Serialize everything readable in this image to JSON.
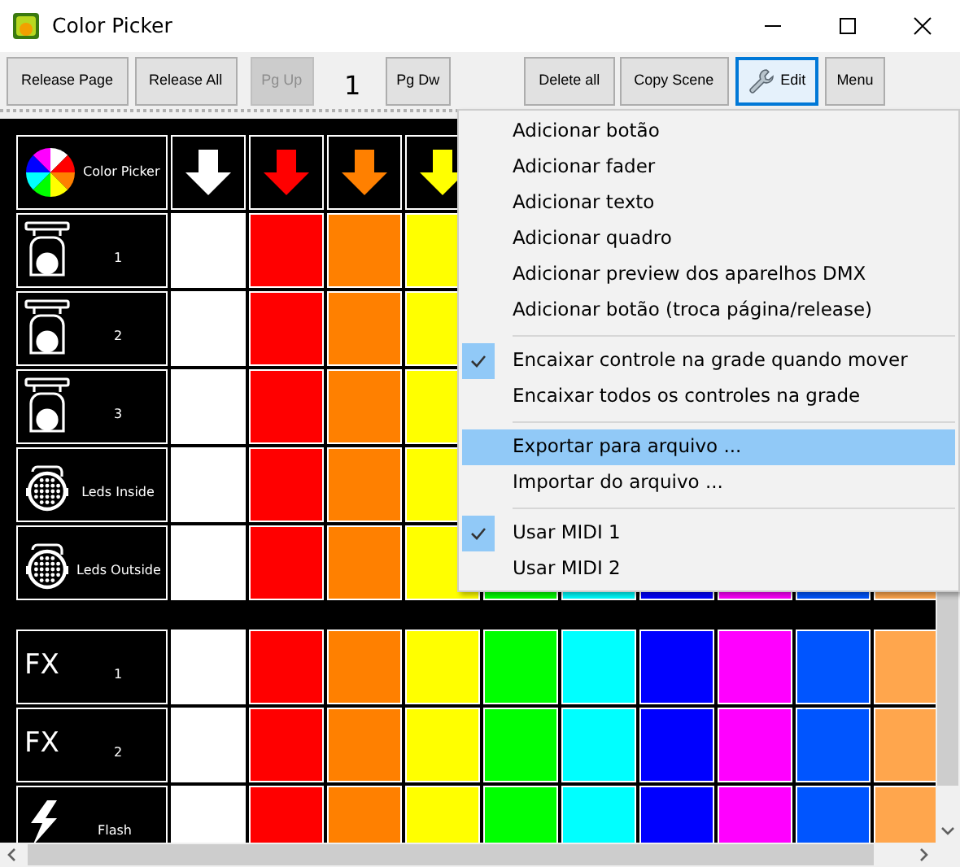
{
  "window": {
    "title": "Color Picker"
  },
  "toolbar": [
    {
      "kind": "button",
      "label": "Release Page",
      "disabled": false,
      "selected": false
    },
    {
      "kind": "button",
      "label": "Release All",
      "disabled": false,
      "selected": false
    },
    {
      "kind": "button",
      "label": "Pg Up",
      "disabled": true,
      "selected": false
    },
    {
      "kind": "page",
      "label": "1"
    },
    {
      "kind": "button",
      "label": "Pg Dw",
      "disabled": false,
      "selected": false
    },
    {
      "kind": "button",
      "label": "Delete all",
      "disabled": false,
      "selected": false
    },
    {
      "kind": "button",
      "label": "Copy Scene",
      "disabled": false,
      "selected": false
    },
    {
      "kind": "icon-button",
      "label": "Edit",
      "disabled": false,
      "selected": true
    },
    {
      "kind": "button",
      "label": "Menu",
      "disabled": false,
      "selected": false
    }
  ],
  "palette": [
    {
      "color": "#ffffff"
    },
    {
      "color": "#ff0000"
    },
    {
      "color": "#ff8000"
    },
    {
      "color": "#ffff00"
    },
    {
      "color": "#00ff00"
    },
    {
      "color": "#00ffff"
    },
    {
      "color": "#0000ff"
    },
    {
      "color": "#ff00ff"
    },
    {
      "color": "#0055ff"
    },
    {
      "color": "#ffa64d"
    }
  ],
  "groups": [
    {
      "rows": [
        {
          "kind": "header",
          "label": "Color Picker"
        },
        {
          "kind": "moving-head",
          "label": "1"
        },
        {
          "kind": "moving-head",
          "label": "2"
        },
        {
          "kind": "moving-head",
          "label": "3"
        },
        {
          "kind": "led-par",
          "label": "Leds Inside"
        },
        {
          "kind": "led-par",
          "label": "Leds Outside"
        }
      ]
    },
    {
      "rows": [
        {
          "kind": "effect",
          "icon_text": "FX",
          "label": "1"
        },
        {
          "kind": "effect",
          "icon_text": "FX",
          "label": "2"
        },
        {
          "kind": "flash",
          "label": "Flash"
        }
      ]
    }
  ],
  "menu": [
    {
      "kind": "item",
      "label": "Adicionar botão",
      "checked": false,
      "selected": false
    },
    {
      "kind": "item",
      "label": "Adicionar fader",
      "checked": false,
      "selected": false
    },
    {
      "kind": "item",
      "label": "Adicionar texto",
      "checked": false,
      "selected": false
    },
    {
      "kind": "item",
      "label": "Adicionar quadro",
      "checked": false,
      "selected": false
    },
    {
      "kind": "item",
      "label": "Adicionar preview dos aparelhos DMX",
      "checked": false,
      "selected": false
    },
    {
      "kind": "item",
      "label": "Adicionar botão (troca página/release)",
      "checked": false,
      "selected": false
    },
    {
      "kind": "separator"
    },
    {
      "kind": "item",
      "label": "Encaixar controle na grade quando mover",
      "checked": true,
      "selected": false
    },
    {
      "kind": "item",
      "label": "Encaixar todos os controles na grade",
      "checked": false,
      "selected": false
    },
    {
      "kind": "separator"
    },
    {
      "kind": "item",
      "label": "Exportar para arquivo ...",
      "checked": false,
      "selected": true
    },
    {
      "kind": "item",
      "label": "Importar do arquivo ...",
      "checked": false,
      "selected": false
    },
    {
      "kind": "separator"
    },
    {
      "kind": "item",
      "label": "Usar MIDI 1",
      "checked": true,
      "selected": false
    },
    {
      "kind": "item",
      "label": "Usar MIDI 2",
      "checked": false,
      "selected": false
    }
  ]
}
